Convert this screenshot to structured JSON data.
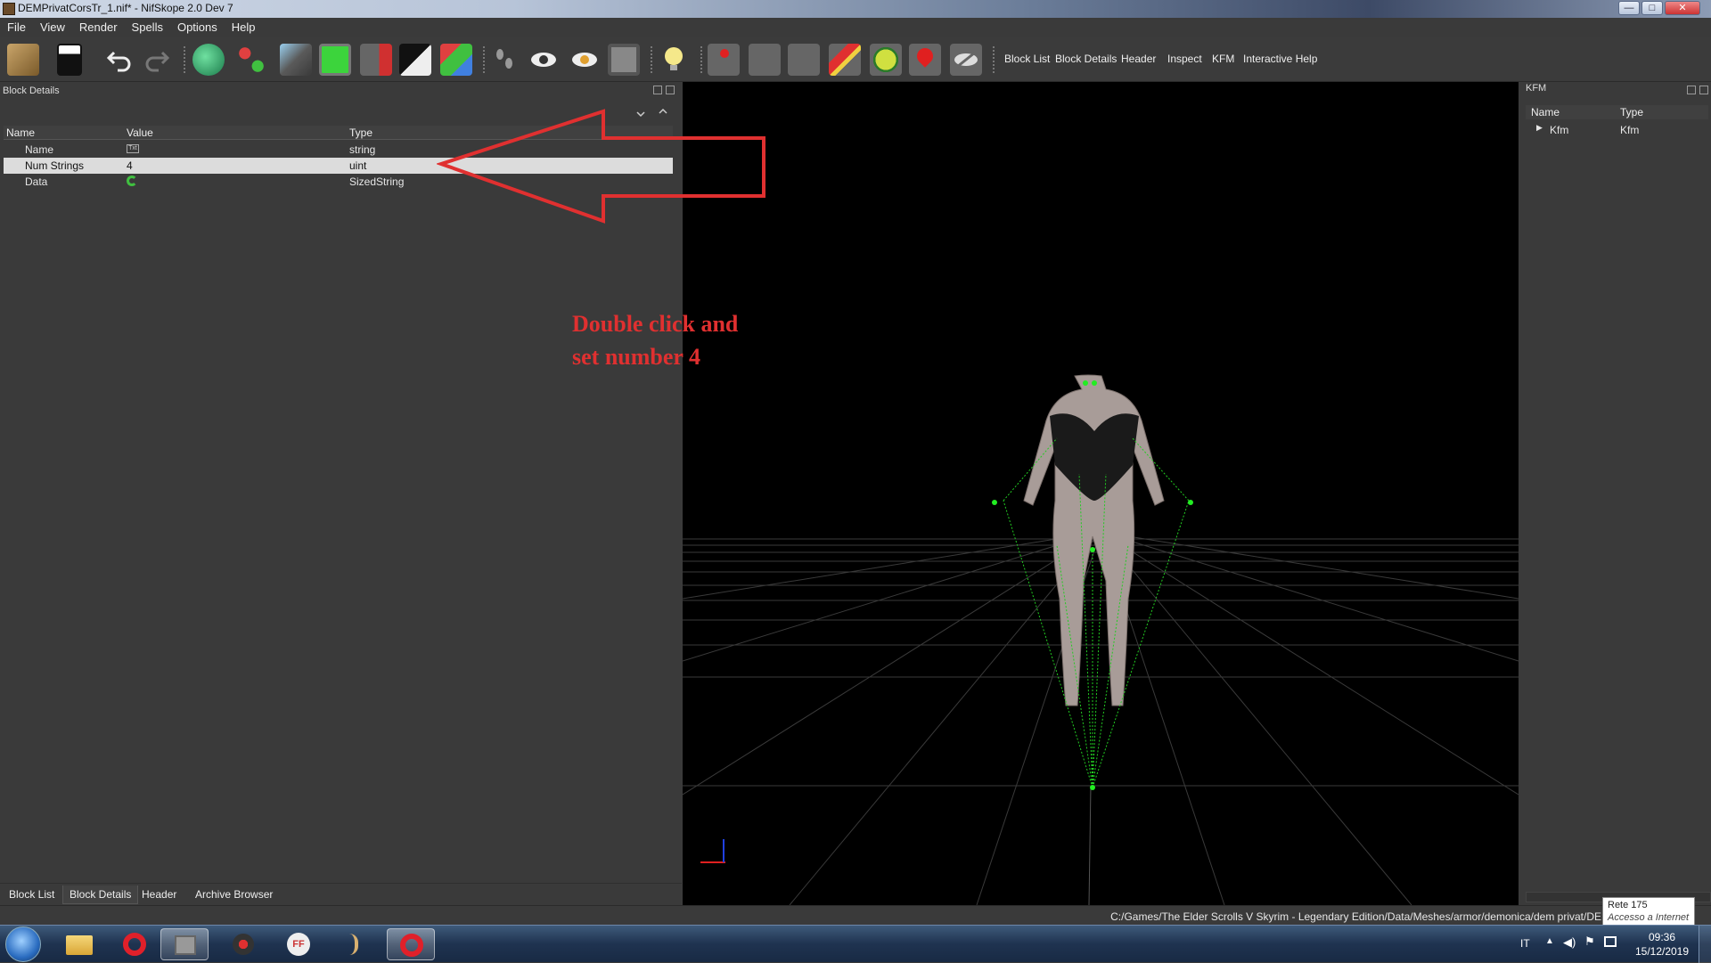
{
  "window": {
    "title": "DEMPrivatCorsTr_1.nif* - NifSkope 2.0 Dev 7",
    "minimize": "—",
    "maximize": "□",
    "close": "✕"
  },
  "menu": [
    "File",
    "View",
    "Render",
    "Spells",
    "Options",
    "Help"
  ],
  "toolbar": {
    "text_buttons": [
      "Block List",
      "Block Details",
      "Header",
      "Inspect",
      "KFM",
      "Interactive Help"
    ]
  },
  "block_details": {
    "title": "Block Details",
    "columns": {
      "name": "Name",
      "value": "Value",
      "type": "Type"
    },
    "rows": [
      {
        "name": "Name",
        "value": "",
        "type": "string"
      },
      {
        "name": "Num Strings",
        "value": "4",
        "type": "uint"
      },
      {
        "name": "Data",
        "value": "",
        "type": "SizedString"
      }
    ]
  },
  "annotation": {
    "line1": "Double click and",
    "line2": "set number 4",
    "color": "#e03030"
  },
  "kfm": {
    "title": "KFM",
    "columns": {
      "name": "Name",
      "type": "Type"
    },
    "row": {
      "name": "Kfm",
      "type": "Kfm"
    }
  },
  "bottom_tabs": [
    "Block List",
    "Block Details",
    "Header",
    "Archive Browser"
  ],
  "status": {
    "path": "C:/Games/The Elder Scrolls V Skyrim - Legendary Edition/Data/Meshes/armor/demonica/dem privat/DEMP"
  },
  "network_tooltip": {
    "line1": "Rete 175",
    "line2": "Accesso a Internet"
  },
  "tray": {
    "language": "IT",
    "time": "09:36",
    "date": "15/12/2019"
  }
}
